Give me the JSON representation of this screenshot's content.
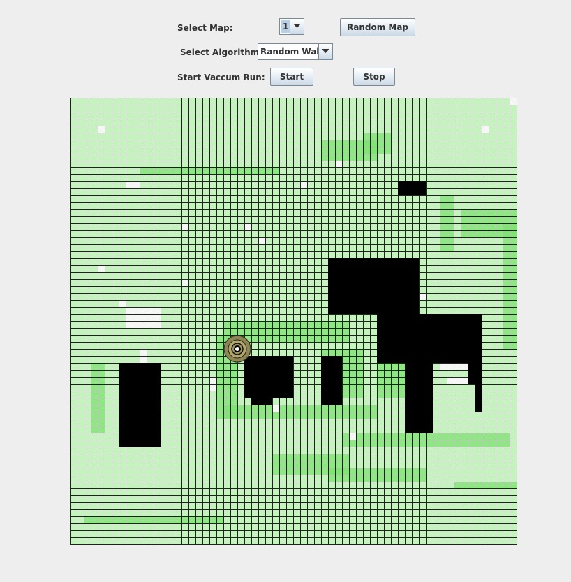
{
  "controls": {
    "select_map_label": "Select Map:",
    "map_value": "1",
    "random_map_button": "Random Map",
    "select_algorithm_label": "Select Algorithm:",
    "algorithm_value": "Random Walk",
    "start_run_label": "Start Vaccum Run:",
    "start_button": "Start",
    "stop_button": "Stop"
  },
  "grid": {
    "rows": 64,
    "cols": 64,
    "colors": {
      "background": "#ffffff",
      "line": "#000000",
      "obstacle": "#000000",
      "clean_light": "#c6f2c0",
      "clean_dark": "#7ee270",
      "uncleaned": "#f4f7f4"
    }
  },
  "robot": {
    "name": "vacuum-robot",
    "color": "#8f8550"
  }
}
